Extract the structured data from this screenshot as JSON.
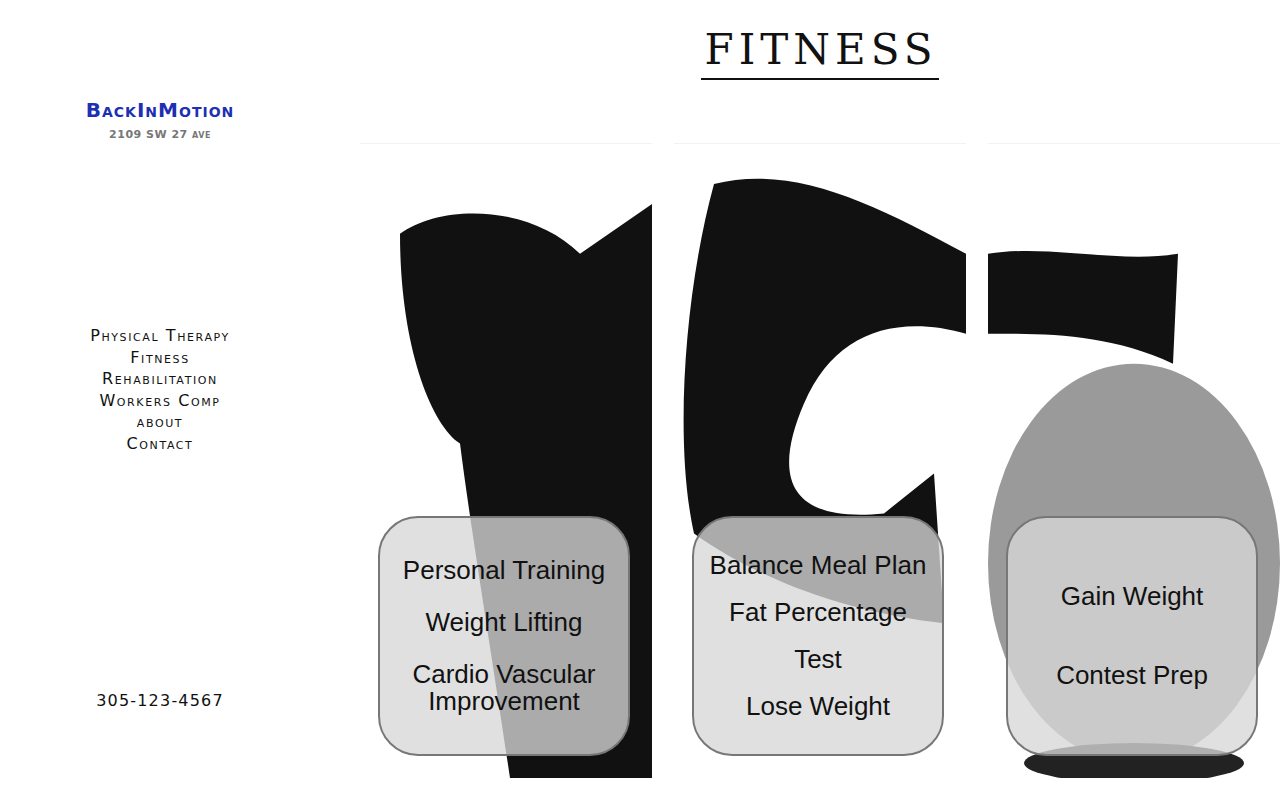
{
  "brand": {
    "logo": "BackInMotion",
    "address": "2109 SW 27 ave"
  },
  "nav": [
    {
      "label": "Physical Therapy"
    },
    {
      "label": "Fitness"
    },
    {
      "label": "Rehabilitation"
    },
    {
      "label": "Workers Comp"
    },
    {
      "label": "about"
    },
    {
      "label": "Contact"
    }
  ],
  "phone": "305-123-4567",
  "heading": "FITNESS",
  "panels": [
    {
      "items": [
        "Personal Training",
        "Weight Lifting",
        "Cardio Vascular Improvement"
      ]
    },
    {
      "items": [
        "Balance Meal Plan",
        "Fat Percentage",
        "Test",
        "Lose Weight"
      ]
    },
    {
      "items": [
        "Gain Weight",
        "Contest Prep"
      ]
    }
  ]
}
